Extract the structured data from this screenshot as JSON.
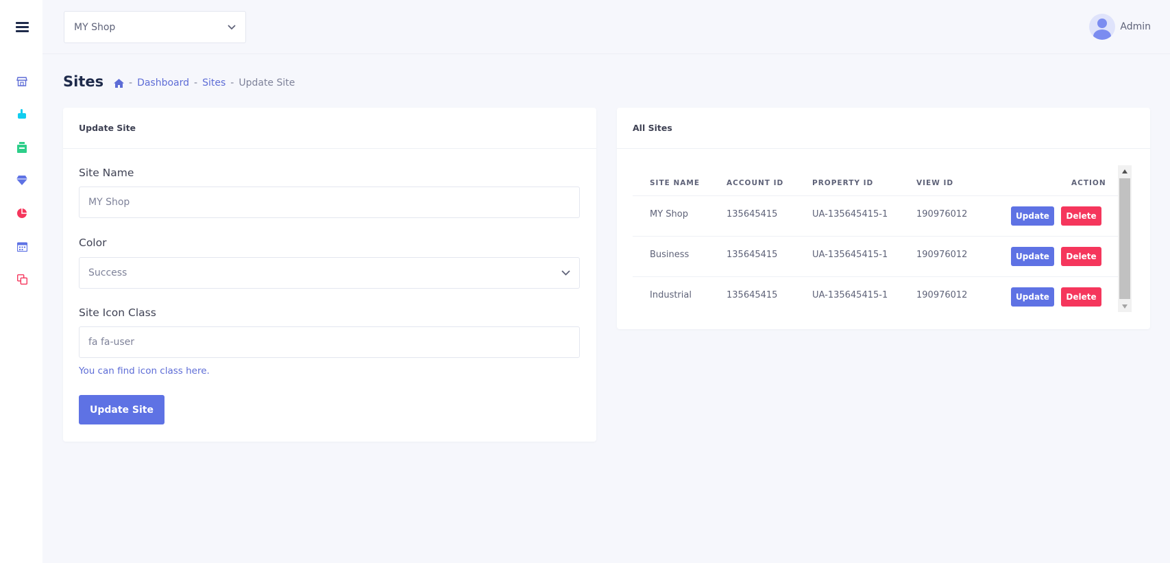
{
  "sidebar": {
    "items": [
      {
        "icon": "store-icon",
        "color": "#5d6cd6"
      },
      {
        "icon": "hand-pointer-icon",
        "color": "#11cdef"
      },
      {
        "icon": "inventory-icon",
        "color": "#2dce89"
      },
      {
        "icon": "diamond-icon",
        "color": "#5e72e4"
      },
      {
        "icon": "pie-chart-icon",
        "color": "#f5365c"
      },
      {
        "icon": "calendar-icon",
        "color": "#5e72e4"
      },
      {
        "icon": "clone-icon",
        "color": "#f5365c"
      }
    ]
  },
  "topbar": {
    "shop_select": "MY Shop",
    "user_name": "Admin"
  },
  "page": {
    "title": "Sites",
    "breadcrumb": {
      "dashboard": "Dashboard",
      "sites": "Sites",
      "current": "Update Site",
      "separator": "-"
    }
  },
  "form_card": {
    "title": "Update Site",
    "site_name_label": "Site Name",
    "site_name_value": "MY Shop",
    "color_label": "Color",
    "color_value": "Success",
    "icon_class_label": "Site Icon Class",
    "icon_class_value": "fa fa-user",
    "help_text": "You can find icon class here.",
    "submit_label": "Update Site"
  },
  "sites_card": {
    "title": "All Sites",
    "columns": [
      "SITE NAME",
      "ACCOUNT ID",
      "PROPERTY ID",
      "VIEW ID",
      "ACTION"
    ],
    "rows": [
      {
        "site_name": "MY Shop",
        "account_id": "135645415",
        "property_id": "UA-135645415-1",
        "view_id": "190976012"
      },
      {
        "site_name": "Business",
        "account_id": "135645415",
        "property_id": "UA-135645415-1",
        "view_id": "190976012"
      },
      {
        "site_name": "Industrial",
        "account_id": "135645415",
        "property_id": "UA-135645415-1",
        "view_id": "190976012"
      }
    ],
    "update_label": "Update",
    "delete_label": "Delete"
  },
  "colors": {
    "primary": "#5e72e4",
    "danger": "#f5365c",
    "link": "#5d6cd6"
  }
}
